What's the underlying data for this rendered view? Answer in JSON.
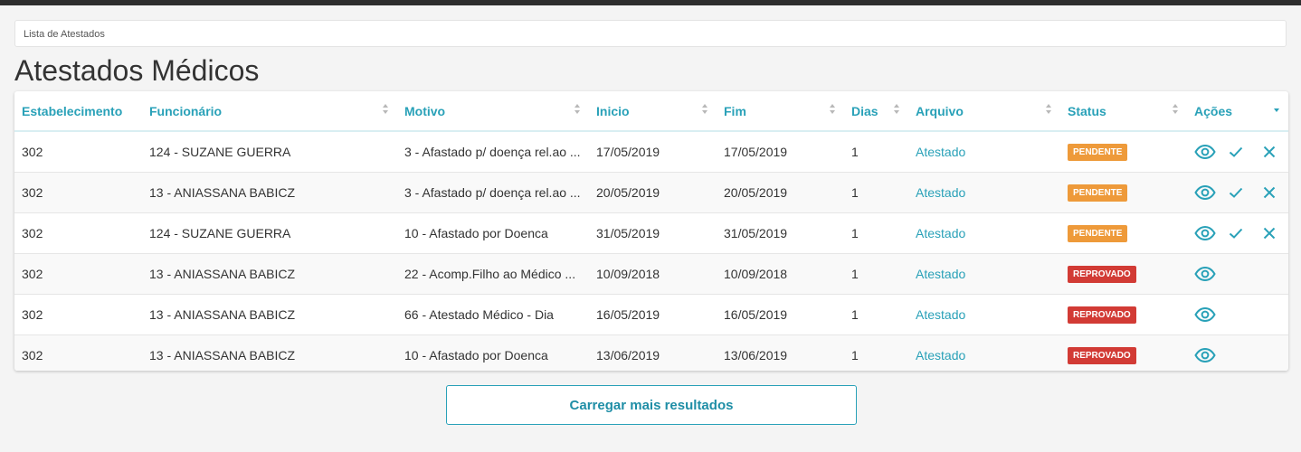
{
  "breadcrumb": "Lista de Atestados",
  "page_title": "Atestados Médicos",
  "columns": [
    "Estabelecimento",
    "Funcionário",
    "Motivo",
    "Inicio",
    "Fim",
    "Dias",
    "Arquivo",
    "Status",
    "Ações"
  ],
  "rows": [
    {
      "estabelecimento": "302",
      "funcionario": "124 - SUZANE GUERRA",
      "motivo": "3 - Afastado p/ doença rel.ao ...",
      "inicio": "17/05/2019",
      "fim": "17/05/2019",
      "dias": "1",
      "arquivo": "Atestado",
      "status": "PENDENTE"
    },
    {
      "estabelecimento": "302",
      "funcionario": "13 - ANIASSANA BABICZ",
      "motivo": "3 - Afastado p/ doença rel.ao ...",
      "inicio": "20/05/2019",
      "fim": "20/05/2019",
      "dias": "1",
      "arquivo": "Atestado",
      "status": "PENDENTE"
    },
    {
      "estabelecimento": "302",
      "funcionario": "124 - SUZANE GUERRA",
      "motivo": "10 - Afastado por Doenca",
      "inicio": "31/05/2019",
      "fim": "31/05/2019",
      "dias": "1",
      "arquivo": "Atestado",
      "status": "PENDENTE"
    },
    {
      "estabelecimento": "302",
      "funcionario": "13 - ANIASSANA BABICZ",
      "motivo": "22 - Acomp.Filho ao Médico ...",
      "inicio": "10/09/2018",
      "fim": "10/09/2018",
      "dias": "1",
      "arquivo": "Atestado",
      "status": "REPROVADO"
    },
    {
      "estabelecimento": "302",
      "funcionario": "13 - ANIASSANA BABICZ",
      "motivo": "66 - Atestado Médico - Dia",
      "inicio": "16/05/2019",
      "fim": "16/05/2019",
      "dias": "1",
      "arquivo": "Atestado",
      "status": "REPROVADO"
    },
    {
      "estabelecimento": "302",
      "funcionario": "13 - ANIASSANA BABICZ",
      "motivo": "10 - Afastado por Doenca",
      "inicio": "13/06/2019",
      "fim": "13/06/2019",
      "dias": "1",
      "arquivo": "Atestado",
      "status": "REPROVADO"
    }
  ],
  "row_actions": [
    "view-icon",
    "check-icon",
    "close-icon"
  ],
  "load_more_label": "Carregar mais resultados",
  "colors": {
    "accent": "#29a1b8",
    "pendente": "#ee9a3a",
    "reprovado": "#d23b35",
    "topbar": "#2e2e2e"
  }
}
